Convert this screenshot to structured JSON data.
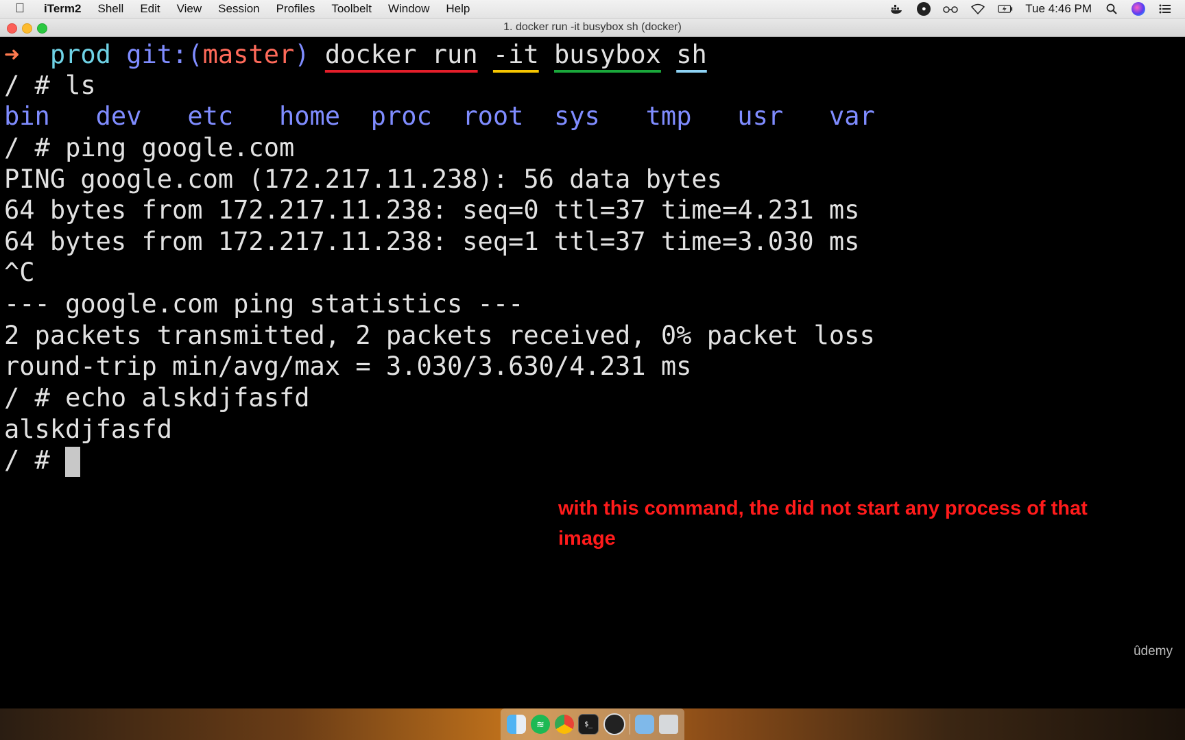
{
  "menubar": {
    "app": "iTerm2",
    "items": [
      "Shell",
      "Edit",
      "View",
      "Session",
      "Profiles",
      "Toolbelt",
      "Window",
      "Help"
    ],
    "clock": "Tue 4:46 PM",
    "status_icons": [
      "docker-icon",
      "obs-icon",
      "glasses-icon",
      "wifi-icon",
      "battery-icon",
      "search-icon",
      "siri-icon",
      "list-icon"
    ]
  },
  "window": {
    "title": "1. docker run -it busybox sh (docker)"
  },
  "terminal": {
    "prompt": {
      "arrow": "➜",
      "dir": "prod",
      "git_prefix": "git:(",
      "branch": "master",
      "git_suffix": ")",
      "cmd_docker_run": "docker run",
      "cmd_it": "-it",
      "cmd_image": "busybox",
      "cmd_sh": "sh"
    },
    "lines": [
      "/ # ls",
      "/ # ping google.com",
      "PING google.com (172.217.11.238): 56 data bytes",
      "64 bytes from 172.217.11.238: seq=0 ttl=37 time=4.231 ms",
      "64 bytes from 172.217.11.238: seq=1 ttl=37 time=3.030 ms",
      "^C",
      "--- google.com ping statistics ---",
      "2 packets transmitted, 2 packets received, 0% packet loss",
      "round-trip min/avg/max = 3.030/3.630/4.231 ms",
      "/ # echo alskdjfasfd",
      "alskdjfasfd",
      "/ # "
    ],
    "ls_output": [
      "bin",
      "dev",
      "etc",
      "home",
      "proc",
      "root",
      "sys",
      "tmp",
      "usr",
      "var"
    ]
  },
  "annotation": {
    "text": "with this command, the did not start any process of that image",
    "color": "#ff1b1b"
  },
  "watermark": "ûdemy",
  "dock": {
    "apps": [
      "finder-icon",
      "spotify-icon",
      "chrome-icon",
      "terminal-icon",
      "obs-icon",
      "folder-icon",
      "trash-icon"
    ]
  }
}
